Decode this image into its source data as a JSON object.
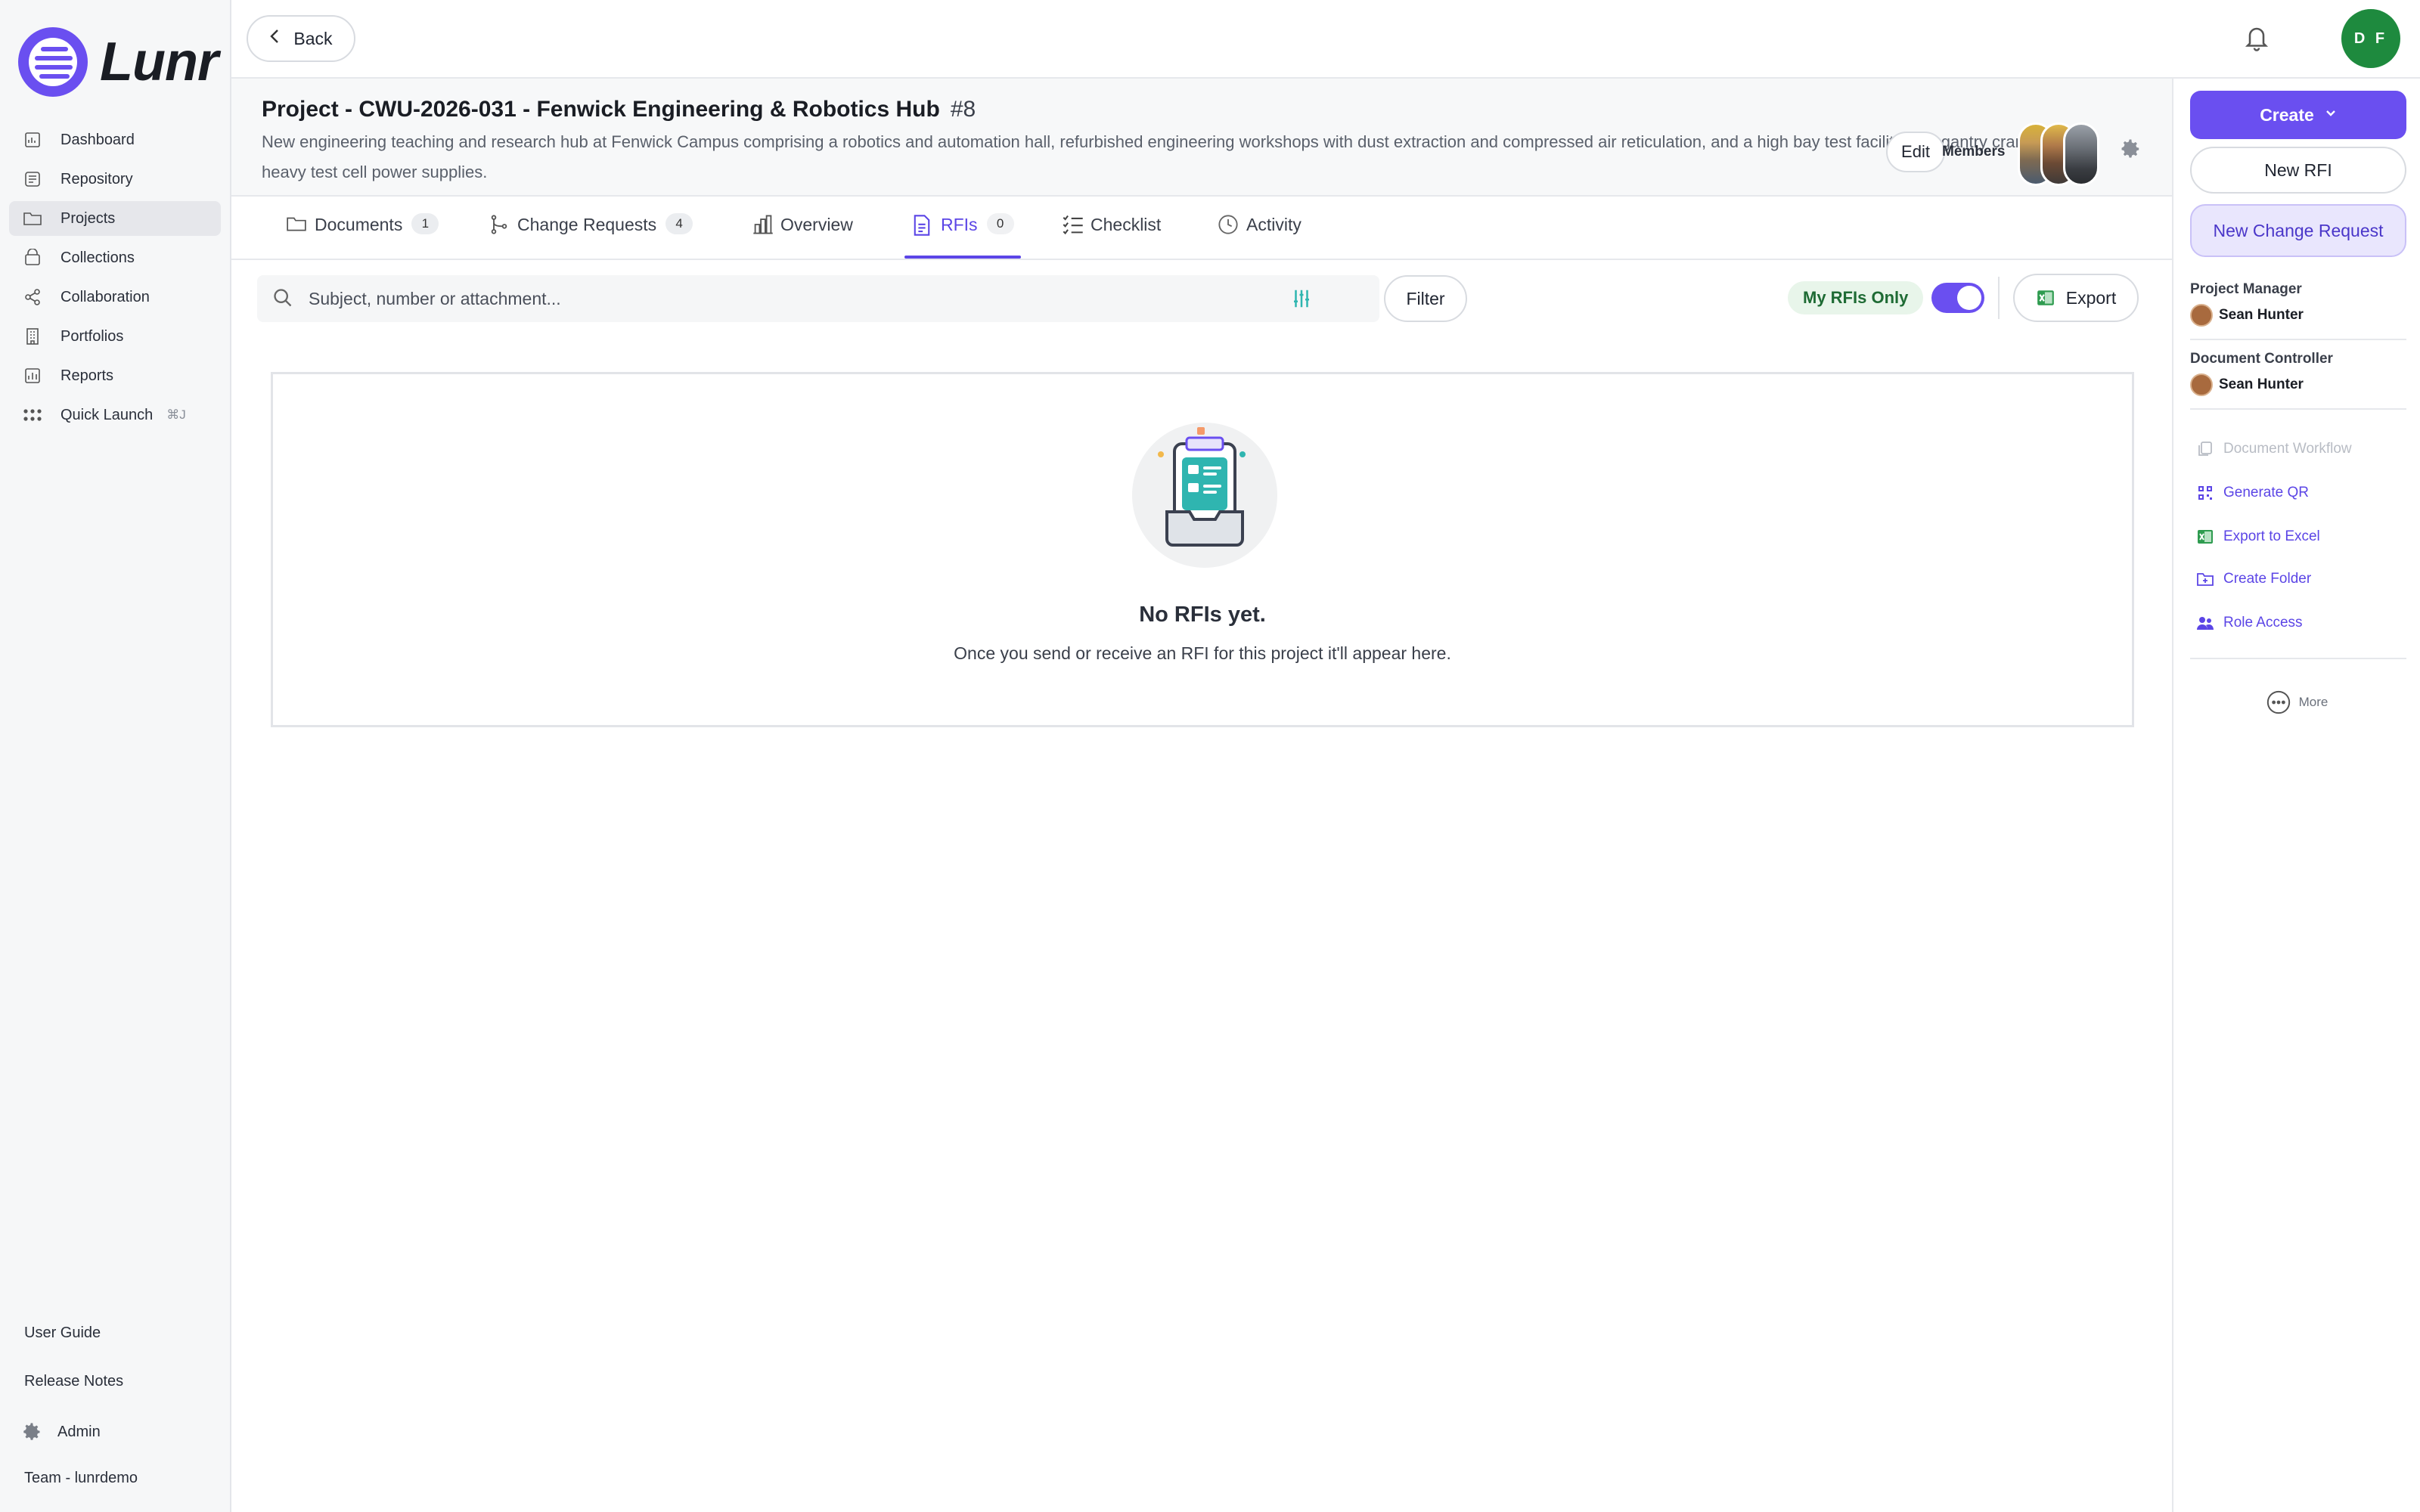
{
  "app": {
    "name": "Lunr"
  },
  "sidebar": {
    "items": [
      {
        "label": "Dashboard",
        "icon": "chart-icon"
      },
      {
        "label": "Repository",
        "icon": "repository-icon"
      },
      {
        "label": "Projects",
        "icon": "folder-icon",
        "active": true
      },
      {
        "label": "Collections",
        "icon": "collection-icon"
      },
      {
        "label": "Collaboration",
        "icon": "share-icon"
      },
      {
        "label": "Portfolios",
        "icon": "building-icon"
      },
      {
        "label": "Reports",
        "icon": "report-icon"
      },
      {
        "label": "Quick Launch",
        "icon": "grid-dots-icon",
        "shortcut": "⌘J"
      }
    ],
    "bottom": {
      "user_guide": "User Guide",
      "release_notes": "Release Notes",
      "admin": "Admin",
      "team": "Team - lunrdemo"
    }
  },
  "topbar": {
    "back_label": "Back",
    "user_initials": "D F"
  },
  "project": {
    "title": "Project - CWU-2026-031 - Fenwick Engineering & Robotics Hub",
    "number": "#8",
    "description": "New engineering teaching and research hub at Fenwick Campus comprising a robotics and automation hall, refurbished engineering workshops with dust extraction and compressed air reticulation, and a high bay test facility with gantry crane and heavy test cell power supplies.",
    "edit_label": "Edit",
    "members_label": "Members"
  },
  "tabs": [
    {
      "label": "Documents",
      "count": "1",
      "icon": "folder-icon"
    },
    {
      "label": "Change Requests",
      "count": "4",
      "icon": "branch-icon"
    },
    {
      "label": "Overview",
      "icon": "bar-chart-icon"
    },
    {
      "label": "RFIs",
      "count": "0",
      "icon": "document-icon",
      "active": true
    },
    {
      "label": "Checklist",
      "icon": "checklist-icon"
    },
    {
      "label": "Activity",
      "icon": "clock-icon"
    }
  ],
  "toolbar": {
    "search_placeholder": "Subject, number or attachment...",
    "filter_label": "Filter",
    "my_rfis_label": "My RFIs Only",
    "my_rfis_on": true,
    "export_label": "Export"
  },
  "empty_state": {
    "title": "No RFIs yet.",
    "subtitle": "Once you send or receive an RFI for this project it'll appear here."
  },
  "right_panel": {
    "create_label": "Create",
    "new_rfi_label": "New RFI",
    "new_change_request_label": "New Change Request",
    "project_manager_label": "Project Manager",
    "project_manager_name": "Sean Hunter",
    "document_controller_label": "Document Controller",
    "document_controller_name": "Sean Hunter",
    "actions": [
      {
        "label": "Document Workflow",
        "enabled": false
      },
      {
        "label": "Generate QR",
        "enabled": true
      },
      {
        "label": "Export to Excel",
        "enabled": true
      },
      {
        "label": "Create Folder",
        "enabled": true
      },
      {
        "label": "Role Access",
        "enabled": true
      }
    ],
    "more_label": "More"
  },
  "colors": {
    "accent": "#6a4ff0",
    "active_tab": "#5b45e6",
    "avatar_green": "#1e8a3e",
    "toggle_bg": "#6a4ff0",
    "myrfi_bg": "#e8f5ea"
  }
}
